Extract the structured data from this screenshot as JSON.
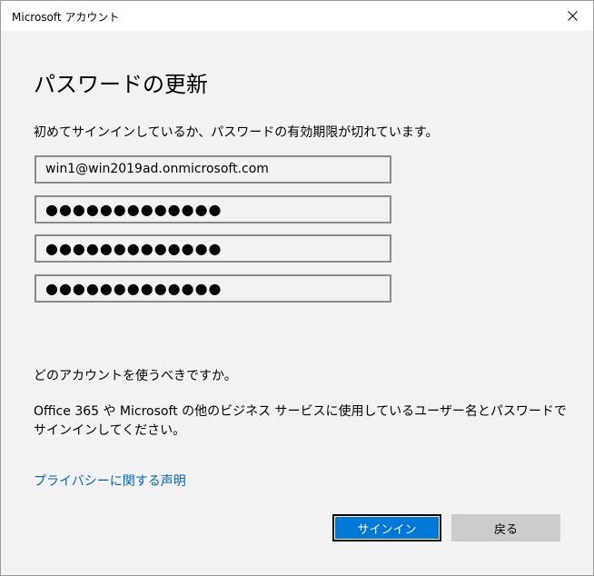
{
  "window": {
    "title": "Microsoft アカウント"
  },
  "main": {
    "heading": "パスワードの更新",
    "description": "初めてサインインしているか、パスワードの有効期限が切れています。",
    "email_value": "win1@win2019ad.onmicrosoft.com",
    "current_password_mask": "●●●●●●●●●●●●●",
    "new_password_mask": "●●●●●●●●●●●●●",
    "confirm_password_mask": "●●●●●●●●●●●●●",
    "question": "どのアカウントを使うべきですか。",
    "info": "Office 365 や Microsoft の他のビジネス サービスに使用しているユーザー名とパスワードでサインインしてください。",
    "privacy_link": "プライバシーに関する声明"
  },
  "buttons": {
    "signin_label": "サインイン",
    "back_label": "戻る"
  },
  "icons": {
    "close": "close-icon"
  },
  "colors": {
    "accent": "#0078d7",
    "link": "#0067b8",
    "background": "#f2f2f2"
  }
}
